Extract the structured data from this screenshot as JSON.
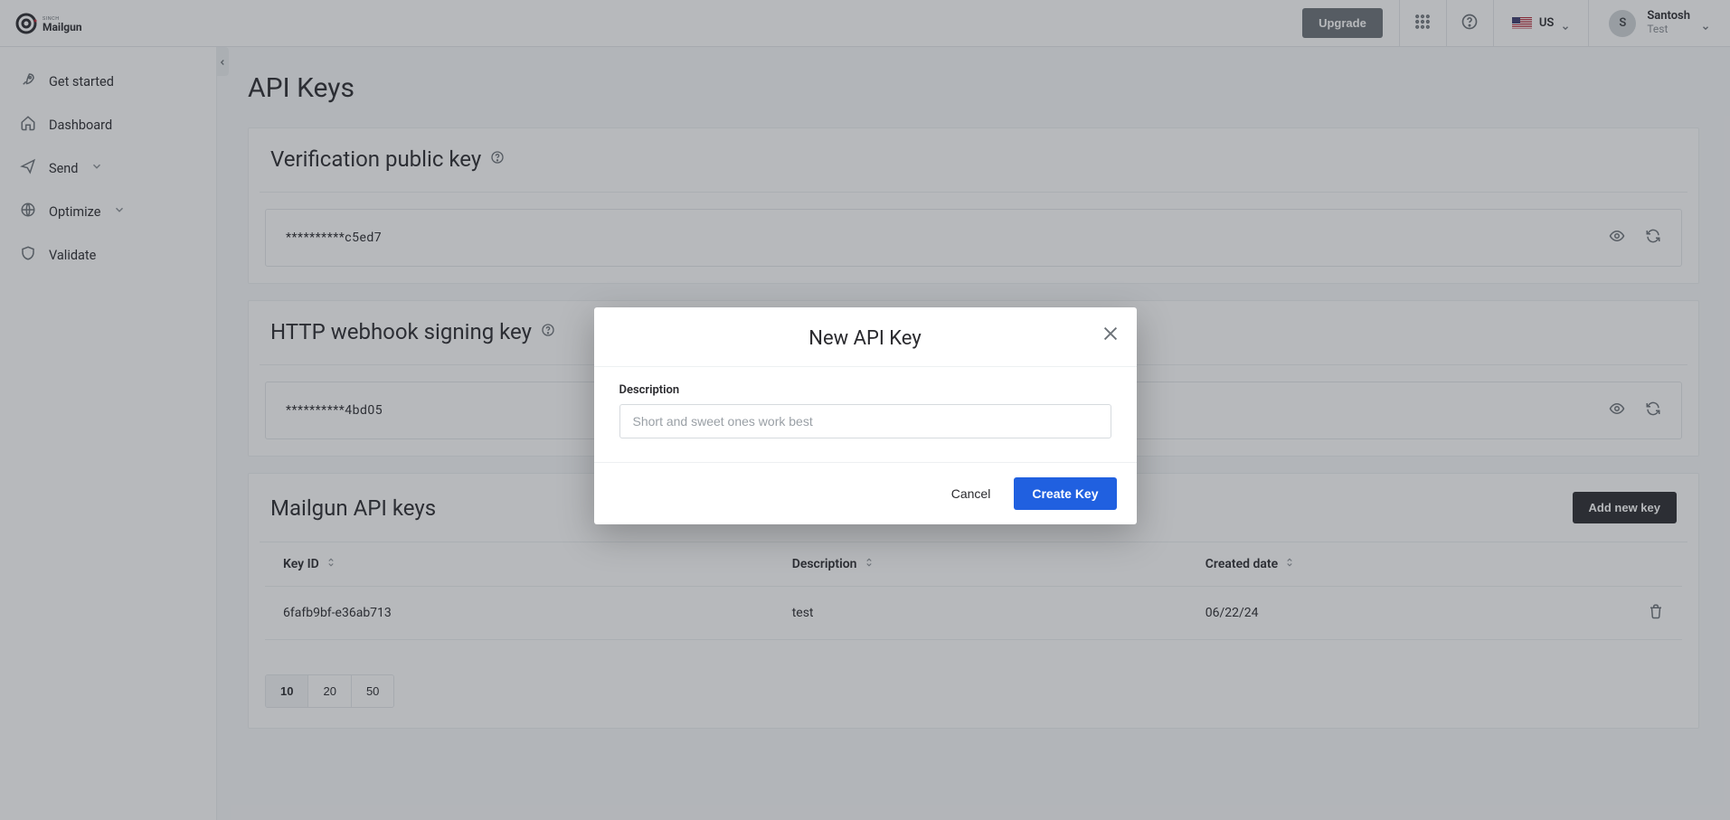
{
  "header": {
    "upgrade_label": "Upgrade",
    "region_code": "US",
    "user_name": "Santosh",
    "user_org": "Test",
    "avatar_initial": "S"
  },
  "sidebar": {
    "items": [
      {
        "icon": "rocket-icon",
        "label": "Get started",
        "expandable": false
      },
      {
        "icon": "home-icon",
        "label": "Dashboard",
        "expandable": false
      },
      {
        "icon": "send-icon",
        "label": "Send",
        "expandable": true
      },
      {
        "icon": "globe-icon",
        "label": "Optimize",
        "expandable": true
      },
      {
        "icon": "shield-icon",
        "label": "Validate",
        "expandable": false
      }
    ]
  },
  "page": {
    "title": "API Keys"
  },
  "verification_panel": {
    "title": "Verification public key",
    "key_masked": "**********c5ed7"
  },
  "webhook_panel": {
    "title": "HTTP webhook signing key",
    "key_masked": "**********4bd05"
  },
  "mailgun_panel": {
    "title": "Mailgun API keys",
    "add_button": "Add new key",
    "columns": {
      "key_id": "Key ID",
      "description": "Description",
      "created": "Created date"
    },
    "rows": [
      {
        "key_id": "6fafb9bf-e36ab713",
        "description": "test",
        "created": "06/22/24"
      }
    ],
    "page_sizes": [
      "10",
      "20",
      "50"
    ],
    "active_page_size": "10"
  },
  "modal": {
    "title": "New API Key",
    "field_label": "Description",
    "placeholder": "Short and sweet ones work best",
    "cancel": "Cancel",
    "create": "Create Key"
  }
}
